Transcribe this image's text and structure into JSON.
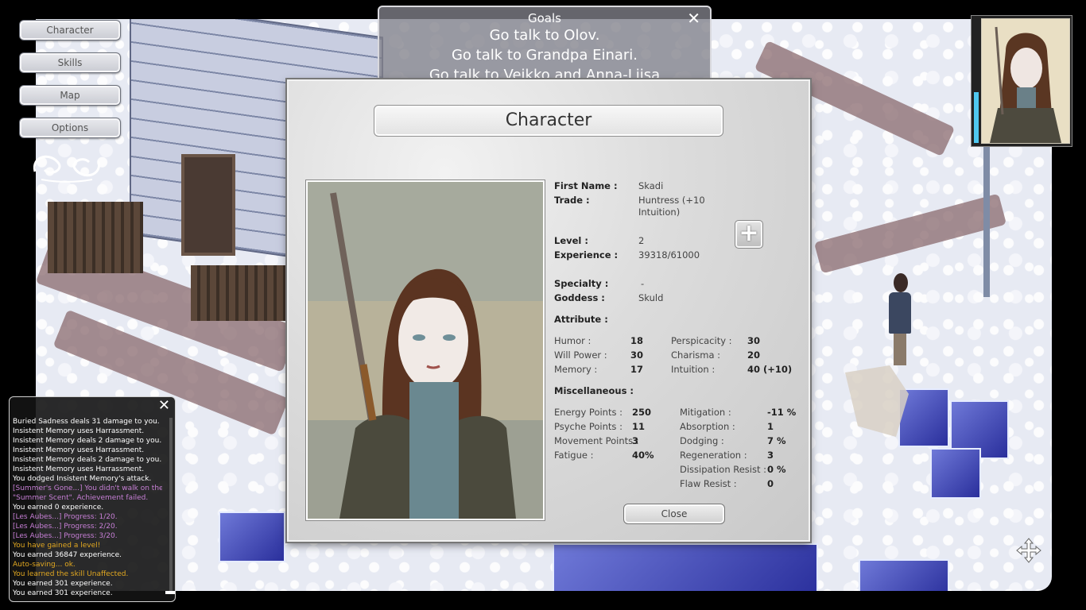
{
  "menu": {
    "character": "Character",
    "skills": "Skills",
    "map": "Map",
    "options": "Options"
  },
  "goals": {
    "title": "Goals",
    "close": "✕",
    "items": [
      "Go talk to Olov.",
      "Go talk to Grandpa Einari.",
      "Go talk to Veikko and Anna-Liisa"
    ]
  },
  "character": {
    "title": "Character",
    "first_name_label": "First Name :",
    "first_name": "Skadi",
    "trade_label": "Trade :",
    "trade_line1": "Huntress (+10",
    "trade_line2": "Intuition)",
    "level_label": "Level :",
    "level": "2",
    "experience_label": "Experience :",
    "experience": "39318/61000",
    "specialty_label": "Specialty :",
    "specialty": "-",
    "goddess_label": "Goddess :",
    "goddess": "Skuld",
    "attribute_label": "Attribute :",
    "attributes_left": [
      {
        "label": "Humor :",
        "value": "18"
      },
      {
        "label": "Will Power :",
        "value": "30"
      },
      {
        "label": "Memory :",
        "value": "17"
      }
    ],
    "attributes_right": [
      {
        "label": "Perspicacity :",
        "value": "30"
      },
      {
        "label": "Charisma :",
        "value": "20"
      },
      {
        "label": "Intuition :",
        "value": "40 (+10)"
      }
    ],
    "misc_label": "Miscellaneous :",
    "misc_left": [
      {
        "label": "Energy Points :",
        "value": "250"
      },
      {
        "label": "Psyche Points :",
        "value": "11"
      },
      {
        "label": "Movement Points :",
        "value": "3"
      },
      {
        "label": "Fatigue :",
        "value": "40%"
      }
    ],
    "misc_right": [
      {
        "label": "Mitigation :",
        "value": "-11 %"
      },
      {
        "label": "Absorption :",
        "value": "1"
      },
      {
        "label": "Dodging :",
        "value": "7 %"
      },
      {
        "label": "Regeneration :",
        "value": "3"
      },
      {
        "label": "Dissipation Resist :",
        "value": "0 %"
      },
      {
        "label": "Flaw Resist :",
        "value": "0"
      }
    ],
    "plus": "+",
    "close_label": "Close"
  },
  "log": {
    "close": "✕",
    "lines": [
      {
        "text": "Buried Sadness deals 31 damage to you.",
        "color": "#ffffff"
      },
      {
        "text": "Insistent Memory uses Harrassment.",
        "color": "#ffffff"
      },
      {
        "text": "Insistent Memory deals 2 damage to you.",
        "color": "#ffffff"
      },
      {
        "text": "Insistent Memory uses Harrassment.",
        "color": "#ffffff"
      },
      {
        "text": "Insistent Memory deals 2 damage to you.",
        "color": "#ffffff"
      },
      {
        "text": "Insistent Memory uses Harrassment.",
        "color": "#ffffff"
      },
      {
        "text": "You dodged Insistent Memory's attack.",
        "color": "#ffffff"
      },
      {
        "text": "[Summer's Gone...] You didn't walk on the",
        "color": "#c77fd6"
      },
      {
        "text": "\"Summer Scent\". Achievement failed.",
        "color": "#c77fd6"
      },
      {
        "text": "You earned 0 experience.",
        "color": "#ffffff"
      },
      {
        "text": "[Les Aubes...] Progress: 1/20.",
        "color": "#c77fd6"
      },
      {
        "text": "[Les Aubes...] Progress: 2/20.",
        "color": "#c77fd6"
      },
      {
        "text": "[Les Aubes...] Progress: 3/20.",
        "color": "#c77fd6"
      },
      {
        "text": "You have gained a level!",
        "color": "#e2a820"
      },
      {
        "text": "You earned 36847 experience.",
        "color": "#ffffff"
      },
      {
        "text": "Auto-saving... ok.",
        "color": "#e2a820"
      },
      {
        "text": "You learned the skill Unaffected.",
        "color": "#e2a820"
      },
      {
        "text": "You earned 301 experience.",
        "color": "#ffffff"
      },
      {
        "text": "You earned 301 experience.",
        "color": "#ffffff"
      }
    ]
  },
  "icons": {
    "ornament": "ornament-icon",
    "move": "move-icon"
  },
  "colors": {
    "hp_bar": "#4fc8f0",
    "log_event": "#c77fd6",
    "log_system": "#e2a820"
  }
}
